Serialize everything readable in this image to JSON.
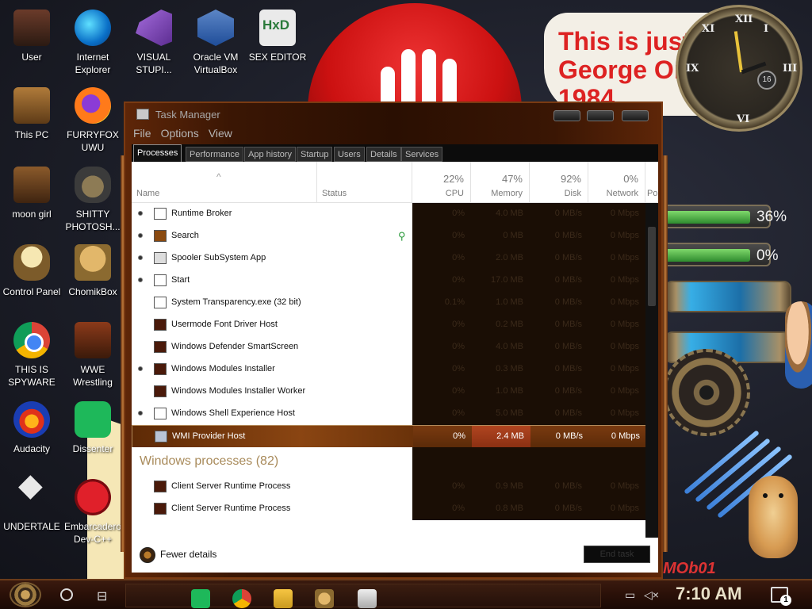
{
  "desktop": {
    "icons": [
      {
        "label": "User",
        "icon": "user-icon"
      },
      {
        "label": "Internet Explorer",
        "icon": "edge-icon"
      },
      {
        "label": "VISUAL STUPI...",
        "icon": "visual-studio-icon"
      },
      {
        "label": "Oracle VM VirtualBox",
        "icon": "virtualbox-icon"
      },
      {
        "label": "SEX EDITOR",
        "icon": "hxd-icon"
      },
      {
        "label": "This PC",
        "icon": "this-pc-icon"
      },
      {
        "label": "FURRYFOX UWU",
        "icon": "firefox-icon"
      },
      {
        "label": "moon girl",
        "icon": "folder-icon"
      },
      {
        "label": "SHITTY PHOTOSH...",
        "icon": "gimp-icon"
      },
      {
        "label": "Control Panel",
        "icon": "control-panel-icon"
      },
      {
        "label": "ChomikBox",
        "icon": "chomikbox-icon"
      },
      {
        "label": "THIS IS SPYWARE",
        "icon": "chrome-icon"
      },
      {
        "label": "WWE Wrestling",
        "icon": "wwe-icon"
      },
      {
        "label": "Audacity",
        "icon": "audacity-icon"
      },
      {
        "label": "Dissenter",
        "icon": "dissenter-icon"
      },
      {
        "label": "UNDERTALE",
        "icon": "unity-icon"
      },
      {
        "label": "Embarcadero Dev-C++",
        "icon": "devcpp-icon"
      }
    ],
    "wallpaper_sign": {
      "line1": "This is just",
      "line2": "George Orwell",
      "line3": "1984"
    },
    "clock_badge": "16",
    "gauges": [
      {
        "value": "36%",
        "level": 0.36
      },
      {
        "value": "0%",
        "level": 0.0
      }
    ],
    "wallpaper_text": "MOb01"
  },
  "task_manager": {
    "title": "Task Manager",
    "menu": [
      "File",
      "Options",
      "View"
    ],
    "tabs": [
      "Processes",
      "Performance",
      "App history",
      "Startup",
      "Users",
      "Details",
      "Services"
    ],
    "active_tab": "Processes",
    "columns": {
      "name": "Name",
      "status": "Status",
      "cpu": {
        "pct": "22%",
        "label": "CPU"
      },
      "memory": {
        "pct": "47%",
        "label": "Memory"
      },
      "disk": {
        "pct": "92%",
        "label": "Disk"
      },
      "network": {
        "pct": "0%",
        "label": "Network"
      },
      "power": "Po"
    },
    "processes": [
      {
        "name": "Runtime Broker",
        "expandable": true,
        "cpu": "0%",
        "memory": "4.0 MB",
        "disk": "0 MB/s",
        "network": "0 Mbps"
      },
      {
        "name": "Search",
        "expandable": true,
        "suspended": true,
        "cpu": "0%",
        "memory": "0 MB",
        "disk": "0 MB/s",
        "network": "0 Mbps"
      },
      {
        "name": "Spooler SubSystem App",
        "expandable": true,
        "cpu": "0%",
        "memory": "2.0 MB",
        "disk": "0 MB/s",
        "network": "0 Mbps"
      },
      {
        "name": "Start",
        "expandable": true,
        "cpu": "0%",
        "memory": "17.0 MB",
        "disk": "0 MB/s",
        "network": "0 Mbps"
      },
      {
        "name": "System Transparency.exe (32 bit)",
        "expandable": false,
        "cpu": "0.1%",
        "memory": "1.0 MB",
        "disk": "0 MB/s",
        "network": "0 Mbps"
      },
      {
        "name": "Usermode Font Driver Host",
        "expandable": false,
        "cpu": "0%",
        "memory": "0.2 MB",
        "disk": "0 MB/s",
        "network": "0 Mbps"
      },
      {
        "name": "Windows Defender SmartScreen",
        "expandable": false,
        "cpu": "0%",
        "memory": "4.0 MB",
        "disk": "0 MB/s",
        "network": "0 Mbps"
      },
      {
        "name": "Windows Modules Installer",
        "expandable": true,
        "cpu": "0%",
        "memory": "0.3 MB",
        "disk": "0 MB/s",
        "network": "0 Mbps"
      },
      {
        "name": "Windows Modules Installer Worker",
        "expandable": false,
        "cpu": "0%",
        "memory": "1.0 MB",
        "disk": "0 MB/s",
        "network": "0 Mbps"
      },
      {
        "name": "Windows Shell Experience Host",
        "expandable": true,
        "cpu": "0%",
        "memory": "5.0 MB",
        "disk": "0 MB/s",
        "network": "0 Mbps"
      },
      {
        "name": "WMI Provider Host",
        "expandable": false,
        "selected": true,
        "cpu": "0%",
        "memory": "2.4 MB",
        "disk": "0 MB/s",
        "network": "0 Mbps"
      }
    ],
    "group_header": "Windows processes (82)",
    "windows_processes": [
      {
        "name": "Client Server Runtime Process",
        "cpu": "0%",
        "memory": "0.9 MB",
        "disk": "0 MB/s",
        "network": "0 Mbps"
      },
      {
        "name": "Client Server Runtime Process",
        "cpu": "0%",
        "memory": "0.8 MB",
        "disk": "0 MB/s",
        "network": "0 Mbps"
      }
    ],
    "fewer_details": "Fewer details",
    "end_task": "End task"
  },
  "taskbar": {
    "time": "7:10 AM",
    "notification_count": "1",
    "apps": [
      "dissenter-icon",
      "chrome-icon",
      "file-explorer-icon",
      "chomikbox-icon",
      "cat-icon"
    ]
  },
  "colors": {
    "accent": "#8a4512",
    "selected_memory": "#b04520",
    "frame": "#3a1604",
    "group_text": "#a88a5a"
  }
}
